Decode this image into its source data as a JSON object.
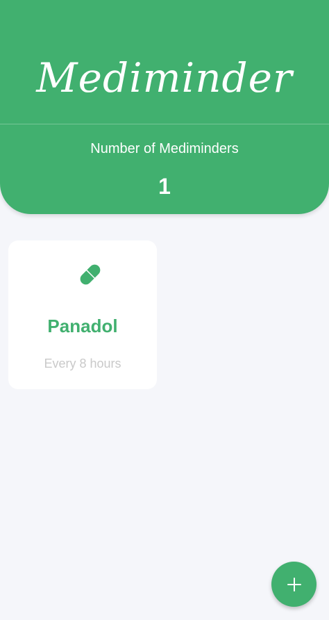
{
  "header": {
    "app_title": "Mediminder",
    "count_label": "Number of Mediminders",
    "count_value": "1"
  },
  "medicines": [
    {
      "name": "Panadol",
      "schedule": "Every 8 hours",
      "icon": "pill-icon"
    }
  ],
  "fab": {
    "icon": "plus-icon"
  },
  "colors": {
    "primary": "#41b06f",
    "background": "#f5f6fa",
    "card": "#ffffff",
    "muted_text": "#c9c9c9"
  }
}
